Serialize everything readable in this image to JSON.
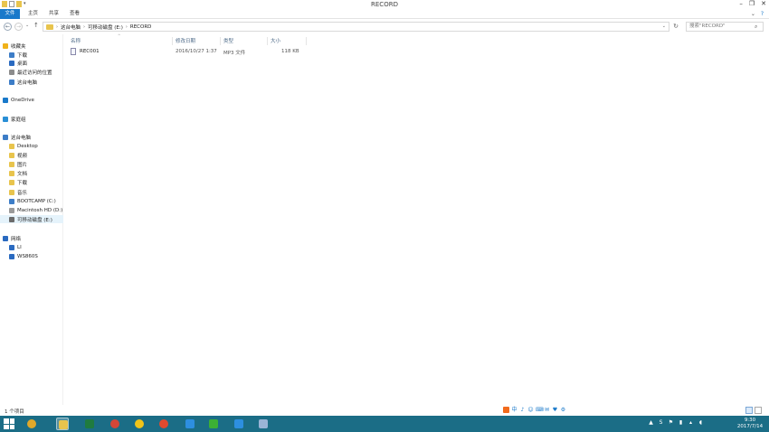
{
  "window": {
    "title": "RECORD",
    "controls": {
      "minimize": "–",
      "restore": "❐",
      "close": "✕"
    }
  },
  "ribbon": {
    "tabs": [
      "文件",
      "主页",
      "共享",
      "查看"
    ],
    "collapse_glyph": "⌄",
    "help_glyph": "?"
  },
  "address": {
    "back": "←",
    "forward": "→",
    "history": "⌄",
    "up": "↑",
    "path": [
      "这台电脑",
      "可移动磁盘 (E:)",
      "RECORD"
    ],
    "separator": "›",
    "dropdown": "⌄",
    "refresh": "↻"
  },
  "search": {
    "placeholder": "搜索\"RECORD\"",
    "icon": "search-icon"
  },
  "navpane": {
    "items": [
      {
        "label": "收藏夹",
        "level": 0,
        "icon": "star-icon",
        "color": "#f0b21a"
      },
      {
        "label": "下载",
        "level": 1,
        "icon": "download-folder-icon",
        "color": "#3d7dc7"
      },
      {
        "label": "桌面",
        "level": 1,
        "icon": "desktop-icon",
        "color": "#2a6ac0"
      },
      {
        "label": "最近访问的位置",
        "level": 1,
        "icon": "recent-places-icon",
        "color": "#8c8c8c"
      },
      {
        "label": "这台电脑",
        "level": 1,
        "icon": "computer-icon",
        "color": "#3d7dc7"
      },
      {
        "label": "OneDrive",
        "level": 0,
        "icon": "cloud-icon",
        "color": "#1979ca"
      },
      {
        "label": "家庭组",
        "level": 0,
        "icon": "homegroup-icon",
        "color": "#2a8fd6"
      },
      {
        "label": "这台电脑",
        "level": 0,
        "icon": "computer-icon",
        "color": "#3d7dc7"
      },
      {
        "label": "Desktop",
        "level": 1,
        "icon": "folder-icon",
        "color": "#e8c44d"
      },
      {
        "label": "视频",
        "level": 1,
        "icon": "folder-icon",
        "color": "#e8c44d"
      },
      {
        "label": "图片",
        "level": 1,
        "icon": "folder-icon",
        "color": "#e8c44d"
      },
      {
        "label": "文档",
        "level": 1,
        "icon": "folder-icon",
        "color": "#e8c44d"
      },
      {
        "label": "下载",
        "level": 1,
        "icon": "folder-icon",
        "color": "#e8c44d"
      },
      {
        "label": "音乐",
        "level": 1,
        "icon": "folder-icon",
        "color": "#e8c44d"
      },
      {
        "label": "BOOTCAMP (C:)",
        "level": 1,
        "icon": "system-drive-icon",
        "color": "#3d7dc7"
      },
      {
        "label": "Macintosh HD (D:)",
        "level": 1,
        "icon": "drive-icon",
        "color": "#9a9a9a"
      },
      {
        "label": "可移动磁盘 (E:)",
        "level": 1,
        "icon": "removable-drive-icon",
        "color": "#6b6b6b",
        "selected": true
      },
      {
        "label": "网络",
        "level": 0,
        "icon": "network-icon",
        "color": "#2a6ac0"
      },
      {
        "label": "LI",
        "level": 1,
        "icon": "network-computer-icon",
        "color": "#2a6ac0"
      },
      {
        "label": "WS860S",
        "level": 1,
        "icon": "network-computer-icon",
        "color": "#2a6ac0"
      }
    ]
  },
  "filelist": {
    "columns": [
      "名称",
      "修改日期",
      "类型",
      "大小"
    ],
    "sort_indicator": "^",
    "rows": [
      {
        "name": "REC001",
        "modified": "2016/10/27 1:37",
        "type": "MP3 文件",
        "size": "118 KB",
        "icon": "audio-file-icon"
      }
    ]
  },
  "status": {
    "item_count": "1 个项目"
  },
  "ime_bar": [
    "中",
    "♪",
    "☺",
    "⌨",
    "✉",
    "♥",
    "⚙"
  ],
  "taskbar": {
    "apps": [
      {
        "name": "taskbar-app-settings",
        "icon": "settings-gear-icon",
        "color": "#e0a82a"
      },
      {
        "name": "taskbar-app-explorer",
        "icon": "folder-icon",
        "color": "#e8c44d",
        "active": true
      },
      {
        "name": "taskbar-app-excel",
        "icon": "excel-icon",
        "color": "#1f7b3f"
      },
      {
        "name": "taskbar-app-chrome",
        "icon": "chrome-icon",
        "color": "#d44638"
      },
      {
        "name": "taskbar-app-paint",
        "icon": "paint-icon",
        "color": "#f0c419"
      },
      {
        "name": "taskbar-app-browser",
        "icon": "browser-icon",
        "color": "#e04a2f"
      },
      {
        "name": "taskbar-app-feather",
        "icon": "feather-icon",
        "color": "#2d8fe0"
      },
      {
        "name": "taskbar-app-wechat",
        "icon": "wechat-icon",
        "color": "#3cb034"
      },
      {
        "name": "taskbar-app-wps",
        "icon": "wps-icon",
        "color": "#2d8fe0"
      },
      {
        "name": "taskbar-app-printer",
        "icon": "printer-icon",
        "color": "#9ab4d6"
      }
    ],
    "tray": [
      "▲",
      "S",
      "⚑",
      "▮",
      "▴",
      "◖"
    ],
    "time": "9:30",
    "date": "2017/7/14"
  },
  "colors": {
    "accent": "#1979ca",
    "taskbar": "#1b6d86",
    "selection": "#e5f3fb"
  }
}
